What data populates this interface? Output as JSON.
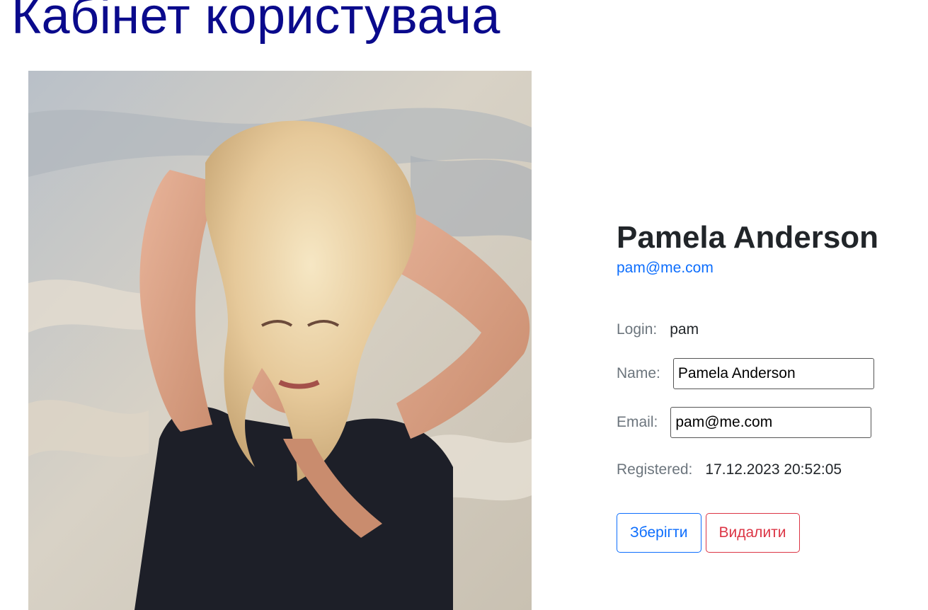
{
  "page": {
    "title": "Кабінет користувача"
  },
  "profile": {
    "photo_alt": "Pamela Anderson",
    "name": "Pamela Anderson",
    "email_link": "pam@me.com",
    "login_label": "Login:",
    "login_value": "pam",
    "name_label": "Name:",
    "name_value": "Pamela Anderson",
    "email_label": "Email:",
    "email_value": "pam@me.com",
    "registered_label": "Registered:",
    "registered_value": "17.12.2023 20:52:05"
  },
  "actions": {
    "save_label": "Зберігти",
    "delete_label": "Видалити"
  },
  "colors": {
    "title": "#0a0a8c",
    "link": "#0d6efd",
    "danger": "#dc3545",
    "label": "#6c757d"
  }
}
